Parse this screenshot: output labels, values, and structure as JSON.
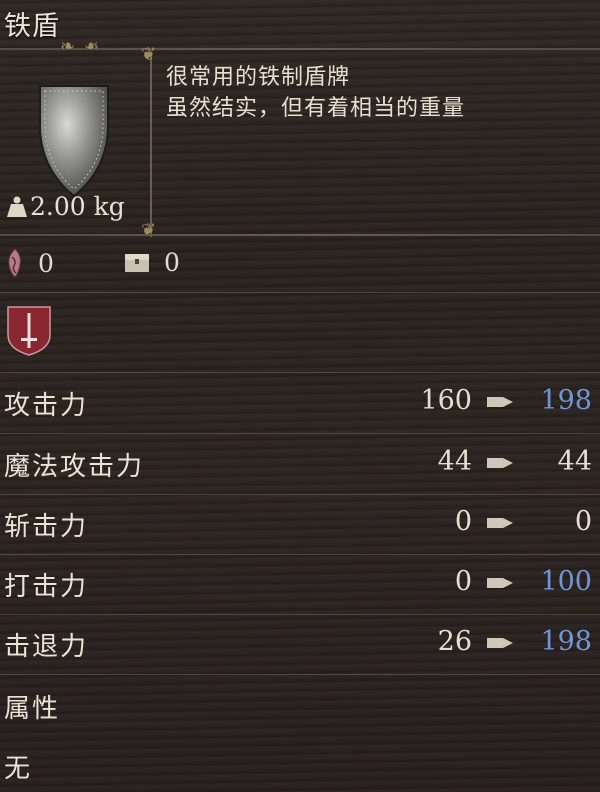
{
  "item": {
    "name": "铁盾",
    "description_line1": "很常用的铁制盾牌",
    "description_line2": "虽然结实，但有着相当的重量",
    "weight": "2.00 kg",
    "icon": "iron-shield-icon"
  },
  "counters": {
    "blood_count": "0",
    "chest_count": "0",
    "blood_icon": "bloodstone-icon",
    "chest_icon": "treasure-chest-icon"
  },
  "badge": {
    "icon": "sword-badge-icon",
    "color": "#8a2630"
  },
  "stats": [
    {
      "label": "攻击力",
      "current": "160",
      "next": "198",
      "next_state": "up"
    },
    {
      "label": "魔法攻击力",
      "current": "44",
      "next": "44",
      "next_state": "same"
    },
    {
      "label": "斩击力",
      "current": "0",
      "next": "0",
      "next_state": "same"
    },
    {
      "label": "打击力",
      "current": "0",
      "next": "100",
      "next_state": "up"
    },
    {
      "label": "击退力",
      "current": "26",
      "next": "198",
      "next_state": "up"
    }
  ],
  "attribute": {
    "label": "属性",
    "value": "无"
  },
  "colors": {
    "increase": "#6f96d8",
    "text": "#e6dfd0",
    "background": "#2b2421"
  }
}
